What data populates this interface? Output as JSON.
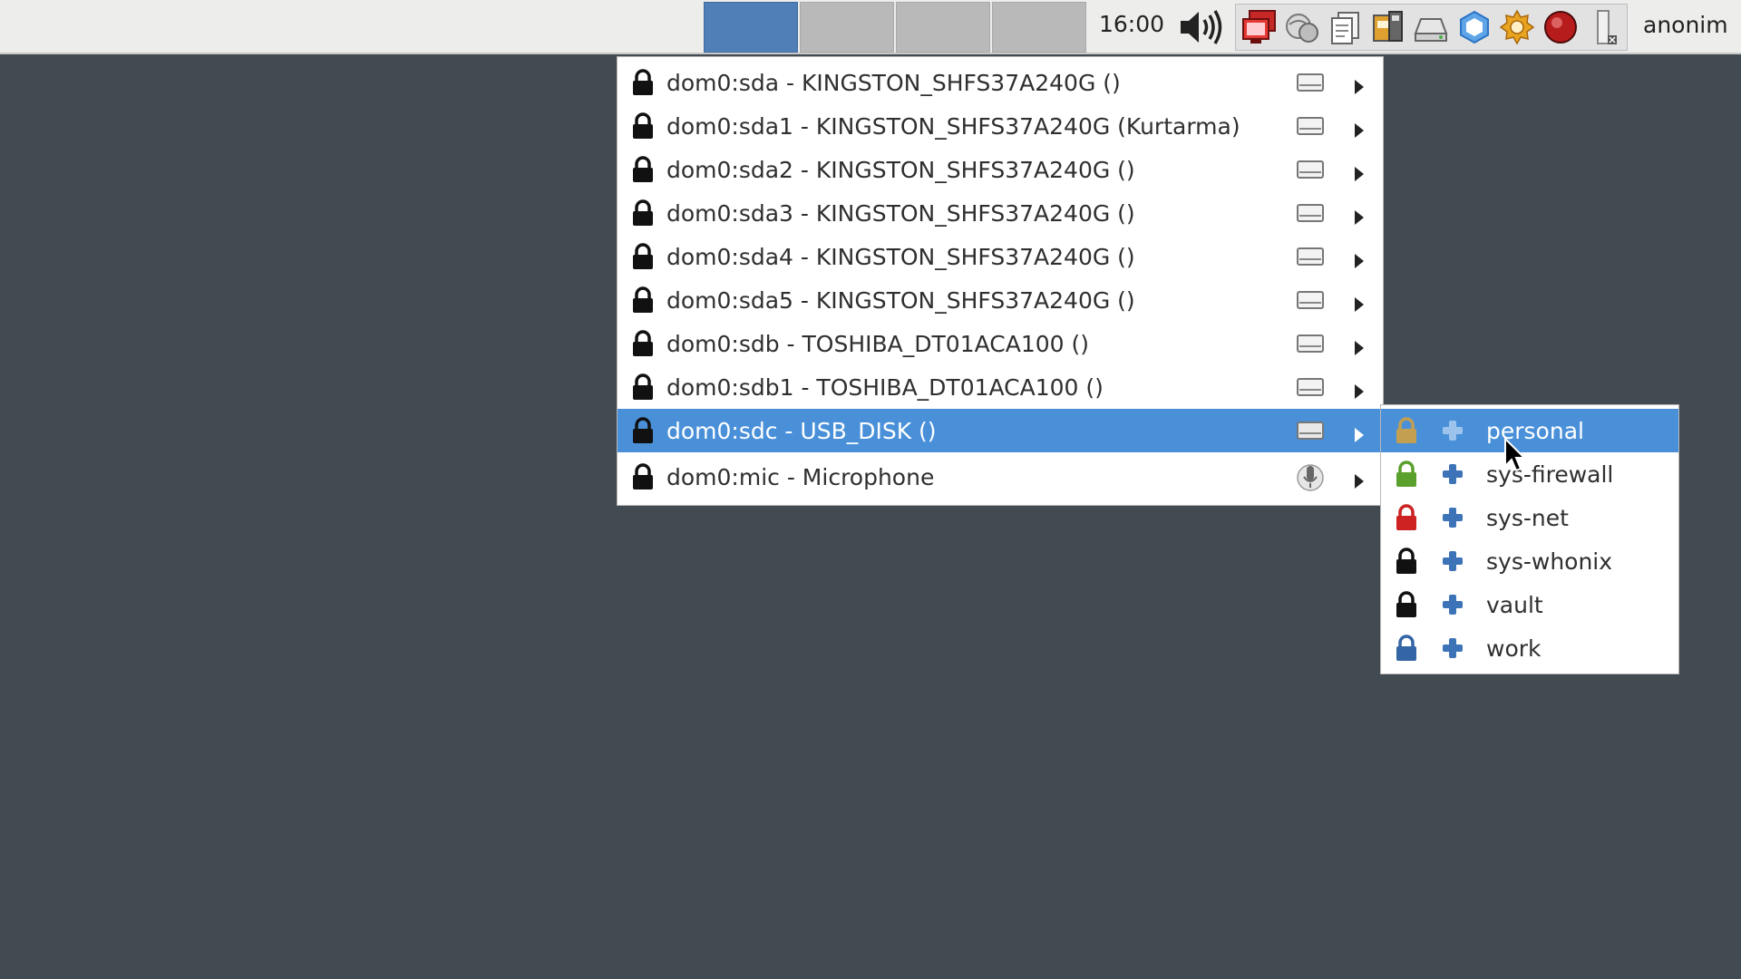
{
  "taskbar": {
    "workspaces": [
      "",
      "",
      "",
      ""
    ],
    "active_workspace": 0,
    "clock": "16:00",
    "user": "anonim",
    "tray_icons": [
      "volume-icon",
      "qubes-domains-icon",
      "network-icon",
      "clipboard-icon",
      "device-manager-icon",
      "disk-icon",
      "qubes-updater-icon",
      "settings-gear-icon",
      "record-icon",
      "battery-icon"
    ]
  },
  "device_menu": {
    "items": [
      {
        "label": "dom0:sda - KINGSTON_SHFS37A240G ()",
        "device_icon": "disk-icon"
      },
      {
        "label": "dom0:sda1 - KINGSTON_SHFS37A240G (Kurtarma)",
        "device_icon": "disk-icon"
      },
      {
        "label": "dom0:sda2 - KINGSTON_SHFS37A240G ()",
        "device_icon": "disk-icon"
      },
      {
        "label": "dom0:sda3 - KINGSTON_SHFS37A240G ()",
        "device_icon": "disk-icon"
      },
      {
        "label": "dom0:sda4 - KINGSTON_SHFS37A240G ()",
        "device_icon": "disk-icon"
      },
      {
        "label": "dom0:sda5 - KINGSTON_SHFS37A240G ()",
        "device_icon": "disk-icon"
      },
      {
        "label": "dom0:sdb - TOSHIBA_DT01ACA100 ()",
        "device_icon": "disk-icon"
      },
      {
        "label": "dom0:sdb1 - TOSHIBA_DT01ACA100 ()",
        "device_icon": "disk-icon"
      },
      {
        "label": "dom0:sdc - USB_DISK ()",
        "device_icon": "disk-icon"
      },
      {
        "label": "dom0:mic - Microphone",
        "device_icon": "microphone-icon"
      }
    ],
    "highlighted_index": 8
  },
  "vm_submenu": {
    "items": [
      {
        "label": "personal",
        "lock_color": "#d8a23a"
      },
      {
        "label": "sys-firewall",
        "lock_color": "#5aa02c"
      },
      {
        "label": "sys-net",
        "lock_color": "#cc2222"
      },
      {
        "label": "sys-whonix",
        "lock_color": "#111111"
      },
      {
        "label": "vault",
        "lock_color": "#111111"
      },
      {
        "label": "work",
        "lock_color": "#3465a4"
      }
    ],
    "highlighted_index": 0
  },
  "colors": {
    "highlight": "#4a90d9",
    "desktop": "#424a52",
    "plus_icon": "#3d74b8"
  }
}
